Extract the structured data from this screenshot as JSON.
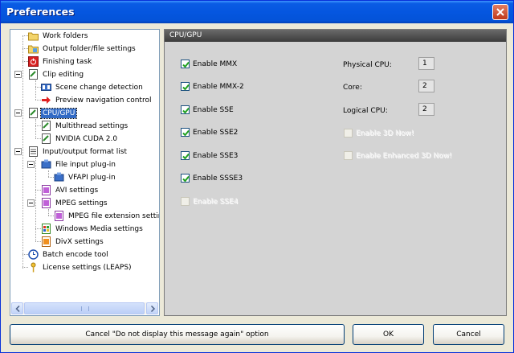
{
  "window": {
    "title": "Preferences"
  },
  "tree": {
    "items": [
      {
        "label": "Work folders",
        "icon": "folder-icon"
      },
      {
        "label": "Output folder/file settings",
        "icon": "folder-settings-icon"
      },
      {
        "label": "Finishing task",
        "icon": "power-task-icon"
      },
      {
        "label": "Clip editing",
        "icon": "clip-editing-icon"
      },
      {
        "label": "Scene change detection",
        "icon": "scene-detection-icon"
      },
      {
        "label": "Preview navigation control",
        "icon": "navigation-arrow-icon"
      },
      {
        "label": "CPU/GPU",
        "icon": "cpu-gpu-icon"
      },
      {
        "label": "Multithread settings",
        "icon": "multithread-icon"
      },
      {
        "label": "NVIDIA CUDA 2.0",
        "icon": "cuda-icon"
      },
      {
        "label": "Input/output format list",
        "icon": "format-list-icon"
      },
      {
        "label": "File input plug-in",
        "icon": "plugin-icon"
      },
      {
        "label": "VFAPI plug-in",
        "icon": "vfapi-plugin-icon"
      },
      {
        "label": "AVI settings",
        "icon": "avi-icon"
      },
      {
        "label": "MPEG settings",
        "icon": "mpeg-icon"
      },
      {
        "label": "MPEG file extension settings",
        "icon": "mpeg-extension-icon"
      },
      {
        "label": "Windows Media settings",
        "icon": "windows-media-icon"
      },
      {
        "label": "DivX settings",
        "icon": "divx-icon"
      },
      {
        "label": "Batch encode tool",
        "icon": "batch-clock-icon"
      },
      {
        "label": "License settings (LEAPS)",
        "icon": "license-key-icon"
      }
    ]
  },
  "content": {
    "header": "CPU/GPU",
    "checkboxes": [
      {
        "label": "Enable MMX",
        "checked": true,
        "enabled": true
      },
      {
        "label": "Enable MMX-2",
        "checked": true,
        "enabled": true
      },
      {
        "label": "Enable SSE",
        "checked": true,
        "enabled": true
      },
      {
        "label": "Enable SSE2",
        "checked": true,
        "enabled": true
      },
      {
        "label": "Enable SSE3",
        "checked": true,
        "enabled": true
      },
      {
        "label": "Enable SSSE3",
        "checked": true,
        "enabled": true
      },
      {
        "label": "Enable SSE4",
        "checked": false,
        "enabled": false
      }
    ],
    "info": [
      {
        "label": "Physical CPU:",
        "value": "1"
      },
      {
        "label": "Core:",
        "value": "2"
      },
      {
        "label": "Logical CPU:",
        "value": "2"
      }
    ],
    "extra_checkboxes": [
      {
        "label": "Enable 3D Now!",
        "checked": false,
        "enabled": false
      },
      {
        "label": "Enable Enhanced 3D Now!",
        "checked": false,
        "enabled": false
      }
    ]
  },
  "buttons": {
    "cancel_option": "Cancel \"Do not display this message again\" option",
    "ok": "OK",
    "cancel": "Cancel"
  },
  "colors": {
    "titlebar": "#0554e0",
    "selection": "#316ac5",
    "check_mark": "#21a121",
    "content_header": "#505050"
  }
}
